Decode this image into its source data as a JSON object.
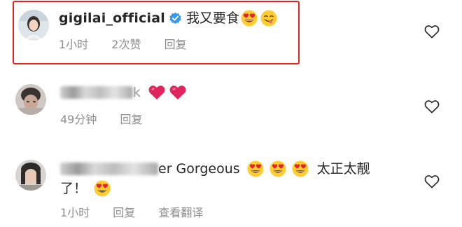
{
  "comments": [
    {
      "username": "gigilai_official",
      "text": "我又要食",
      "time": "1小时",
      "likes": "2次赞",
      "reply": "回复"
    },
    {
      "text_suffix": "k",
      "time": "49分钟",
      "reply": "回复"
    },
    {
      "username_suffix": "er",
      "text_part1": "Gorgeous",
      "text_part2": "太正太靓",
      "text_line2": "了！",
      "time": "1小时",
      "reply": "回复",
      "translate": "查看翻译"
    }
  ],
  "colors": {
    "highlight": "#e5231b",
    "verified": "#3897f0",
    "heart": "#e0245e",
    "meta": "#8e8e8e"
  },
  "icons": {
    "verified": "verified-badge-icon",
    "like": "heart-outline-icon",
    "heart_eyes": "heart-eyes-emoji",
    "yum": "yum-emoji",
    "red_heart": "red-heart-emoji"
  }
}
